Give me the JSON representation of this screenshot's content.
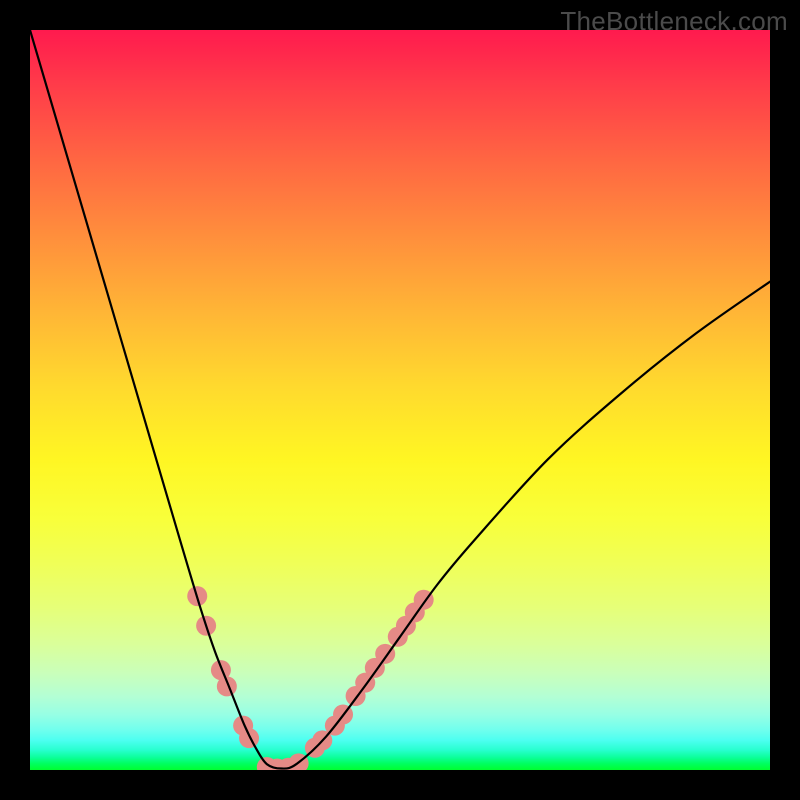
{
  "watermark": {
    "text": "TheBottleneck.com"
  },
  "chart_data": {
    "type": "line",
    "title": "",
    "xlabel": "",
    "ylabel": "",
    "xlim": [
      0,
      100
    ],
    "ylim": [
      0,
      100
    ],
    "background_gradient": {
      "top_color": "#ff1a4e",
      "mid_color": "#fff623",
      "bottom_color": "#00ff30"
    },
    "series": [
      {
        "name": "bottleneck-curve",
        "color": "#000000",
        "x": [
          0,
          5,
          10,
          15,
          20,
          23,
          25,
          27,
          29,
          30.5,
          32,
          34,
          36,
          40,
          45,
          50,
          55,
          60,
          70,
          80,
          90,
          100
        ],
        "y": [
          100,
          83,
          66,
          49,
          32,
          22,
          16,
          11,
          6,
          3,
          0.8,
          0.2,
          0.8,
          4.5,
          11,
          18,
          25,
          31,
          42,
          51,
          59,
          66
        ]
      }
    ],
    "markers": [
      {
        "name": "highlight-dots",
        "color": "#e58a86",
        "radius_px": 10,
        "points": [
          {
            "x": 22.6,
            "y": 23.5
          },
          {
            "x": 23.8,
            "y": 19.5
          },
          {
            "x": 25.8,
            "y": 13.5
          },
          {
            "x": 26.6,
            "y": 11.3
          },
          {
            "x": 28.8,
            "y": 6.0
          },
          {
            "x": 29.6,
            "y": 4.3
          },
          {
            "x": 32.0,
            "y": 0.4
          },
          {
            "x": 33.4,
            "y": 0.2
          },
          {
            "x": 34.9,
            "y": 0.3
          },
          {
            "x": 36.3,
            "y": 0.9
          },
          {
            "x": 38.5,
            "y": 3.0
          },
          {
            "x": 39.5,
            "y": 4.0
          },
          {
            "x": 41.2,
            "y": 6.0
          },
          {
            "x": 42.3,
            "y": 7.5
          },
          {
            "x": 44.0,
            "y": 10.0
          },
          {
            "x": 45.3,
            "y": 11.8
          },
          {
            "x": 46.6,
            "y": 13.8
          },
          {
            "x": 48.0,
            "y": 15.7
          },
          {
            "x": 49.7,
            "y": 18.0
          },
          {
            "x": 50.8,
            "y": 19.5
          },
          {
            "x": 52.0,
            "y": 21.3
          },
          {
            "x": 53.2,
            "y": 23.0
          }
        ]
      }
    ]
  }
}
